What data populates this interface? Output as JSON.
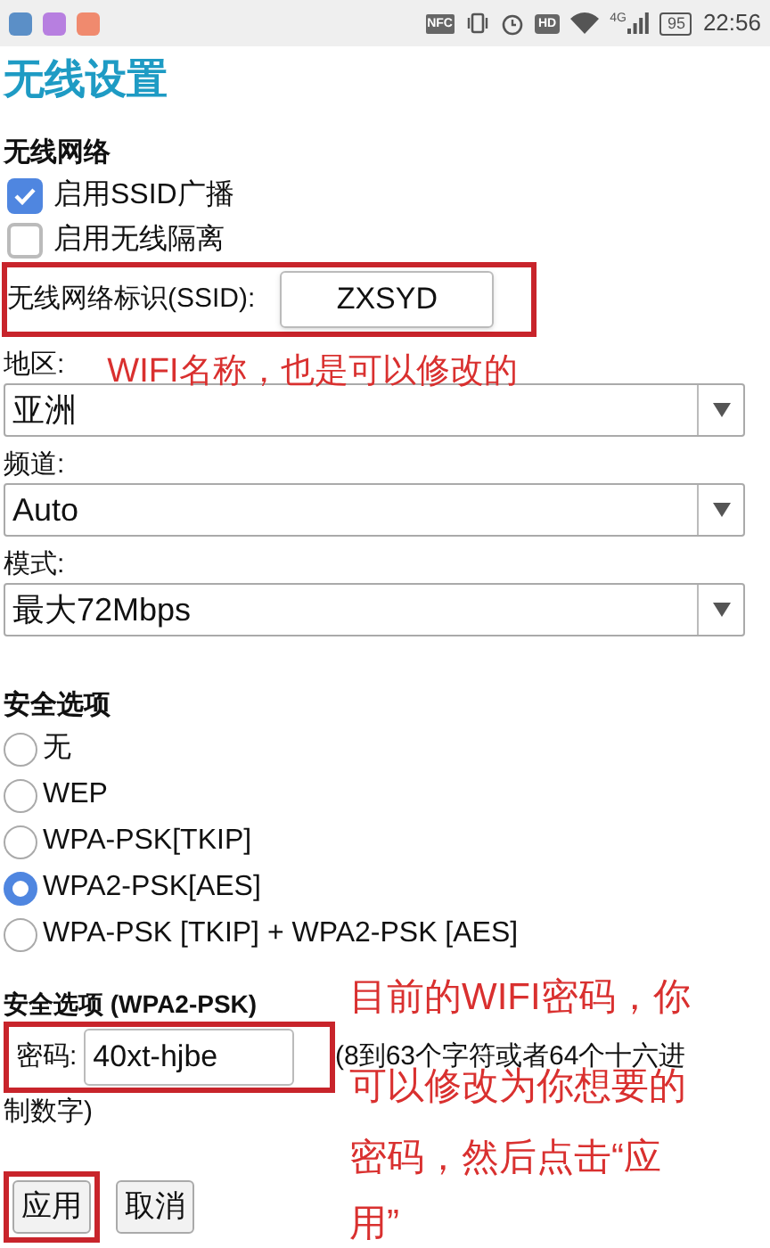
{
  "status_bar": {
    "notification_icons": [
      {
        "color": "#5b8fc7"
      },
      {
        "color": "#b77fe0"
      },
      {
        "color": "#f08a6e"
      }
    ],
    "nfc": "NFC",
    "hd": "HD",
    "network": "4G",
    "battery": "95",
    "time": "22:56"
  },
  "title": "无线设置",
  "wireless": {
    "heading": "无线网络",
    "options": [
      {
        "label": "启用SSID广播",
        "checked": true
      },
      {
        "label": "启用无线隔离",
        "checked": false
      }
    ],
    "ssid": {
      "label": "无线网络标识(SSID):",
      "value": "ZXSYD",
      "highlighted": true
    },
    "selects": [
      {
        "label": "地区:",
        "value": "亚洲",
        "annotation": "WIFI名称，也是可以修改的"
      },
      {
        "label": "频道:",
        "value": "Auto"
      },
      {
        "label": "模式:",
        "value": "最大72Mbps"
      }
    ]
  },
  "security": {
    "heading": "安全选项",
    "options": [
      {
        "label": "无",
        "selected": false
      },
      {
        "label": "WEP",
        "selected": false
      },
      {
        "label": "WPA-PSK[TKIP]",
        "selected": false
      },
      {
        "label": "WPA2-PSK[AES]",
        "selected": true
      },
      {
        "label": "WPA-PSK [TKIP] + WPA2-PSK [AES]",
        "selected": false
      }
    ]
  },
  "psk": {
    "heading": "安全选项 (WPA2-PSK)",
    "password_label": "密码:",
    "password": "40xt-hjbe",
    "highlighted": true,
    "note": "(8到63个字符或者64个十六进",
    "note_continued": "制数字)"
  },
  "buttons": [
    {
      "label": "应用",
      "highlighted": true
    },
    {
      "label": "取消",
      "highlighted": false
    }
  ],
  "annotation": [
    "目前的WIFI密码，你",
    "可以修改为你想要的",
    "密码，然后点击“应",
    "用”"
  ]
}
